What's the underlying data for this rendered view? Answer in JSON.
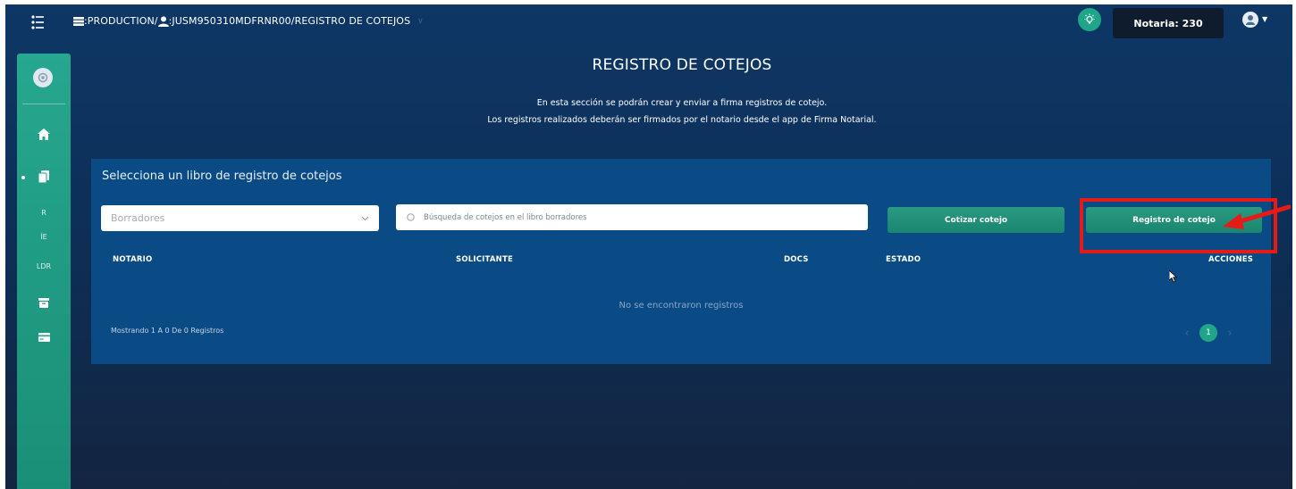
{
  "topbar": {
    "crumb_env": ":PRODUCTION/",
    "crumb_user": ":JUSM950310MDFRNR00/REGISTRO DE COTEJOS",
    "crumb_chevron": "∨",
    "notaria_label": "Notaria: 230"
  },
  "sidebar": {
    "items": [
      {
        "name": "home",
        "icon": "home-icon"
      },
      {
        "name": "documents",
        "icon": "documents-icon"
      },
      {
        "label": "R"
      },
      {
        "label": "ÍE"
      },
      {
        "label": "LDR"
      },
      {
        "name": "archive",
        "icon": "archive-icon"
      },
      {
        "name": "card",
        "icon": "card-icon"
      }
    ]
  },
  "header": {
    "title": "REGISTRO DE COTEJOS",
    "description_line1": "En esta sección se podrán crear y enviar a firma registros de cotejo.",
    "description_line2": "Los registros realizados deberán ser firmados por el notario desde el app de Firma Notarial."
  },
  "card": {
    "title": "Selecciona un libro de registro de cotejos",
    "select_value": "Borradores",
    "search_placeholder": "Búsqueda de cotejos en el libro borradores",
    "cotizar_label": "Cotizar cotejo",
    "registro_label": "Registro de cotejo",
    "columns": [
      "NOTARIO",
      "SOLICITANTE",
      "DOCS",
      "ESTADO",
      "ACCIONES"
    ],
    "empty_text": "No se encontraron registros",
    "showing_text": "Mostrando 1 A 0 De 0 Registros",
    "current_page": "1",
    "prev_arrow": "‹",
    "next_arrow": "›"
  },
  "colors": {
    "accent_green": "#1fa58a",
    "background_blue": "#0e3766",
    "card_blue": "#0a4b86",
    "annotation_red": "#e51b18"
  }
}
